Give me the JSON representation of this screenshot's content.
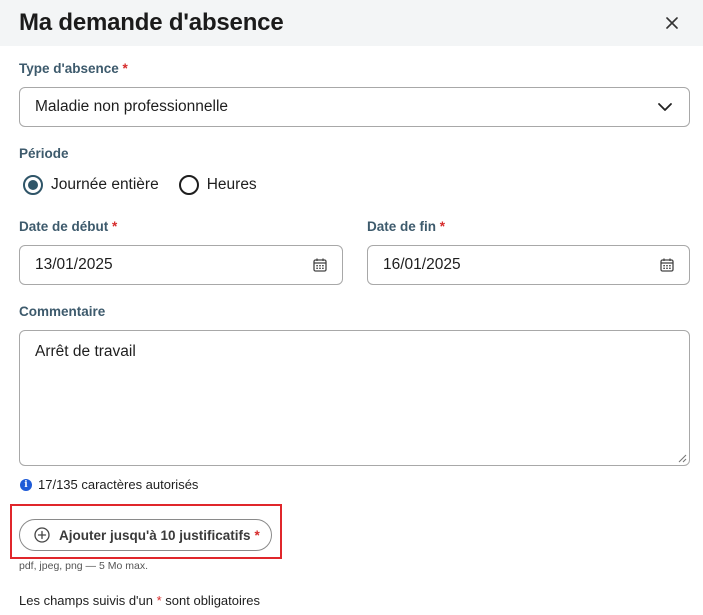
{
  "dialog": {
    "title": "Ma demande d'absence",
    "close_label": "×"
  },
  "form": {
    "required_marker": "*",
    "absence_type": {
      "label": "Type d'absence",
      "value": "Maladie non professionnelle"
    },
    "period": {
      "label": "Période",
      "options": [
        {
          "label": "Journée entière",
          "checked": true
        },
        {
          "label": "Heures",
          "checked": false
        }
      ]
    },
    "start_date": {
      "label": "Date de début",
      "value": "13/01/2025"
    },
    "end_date": {
      "label": "Date de fin",
      "value": "16/01/2025"
    },
    "comment": {
      "label": "Commentaire",
      "value": "Arrêt de travail",
      "counter": "17/135 caractères autorisés"
    },
    "attachments": {
      "button_label": "Ajouter jusqu'à 10 justificatifs",
      "hint": "pdf, jpeg, png — 5 Mo max."
    },
    "footnote": {
      "before": "Les champs suivis d'un ",
      "after": " sont obligatoires"
    }
  },
  "colors": {
    "accent": "#2f5568",
    "label": "#3d5a6c",
    "required": "#d62b2b",
    "highlight": "#e0262b",
    "info": "#1e5bd7"
  }
}
